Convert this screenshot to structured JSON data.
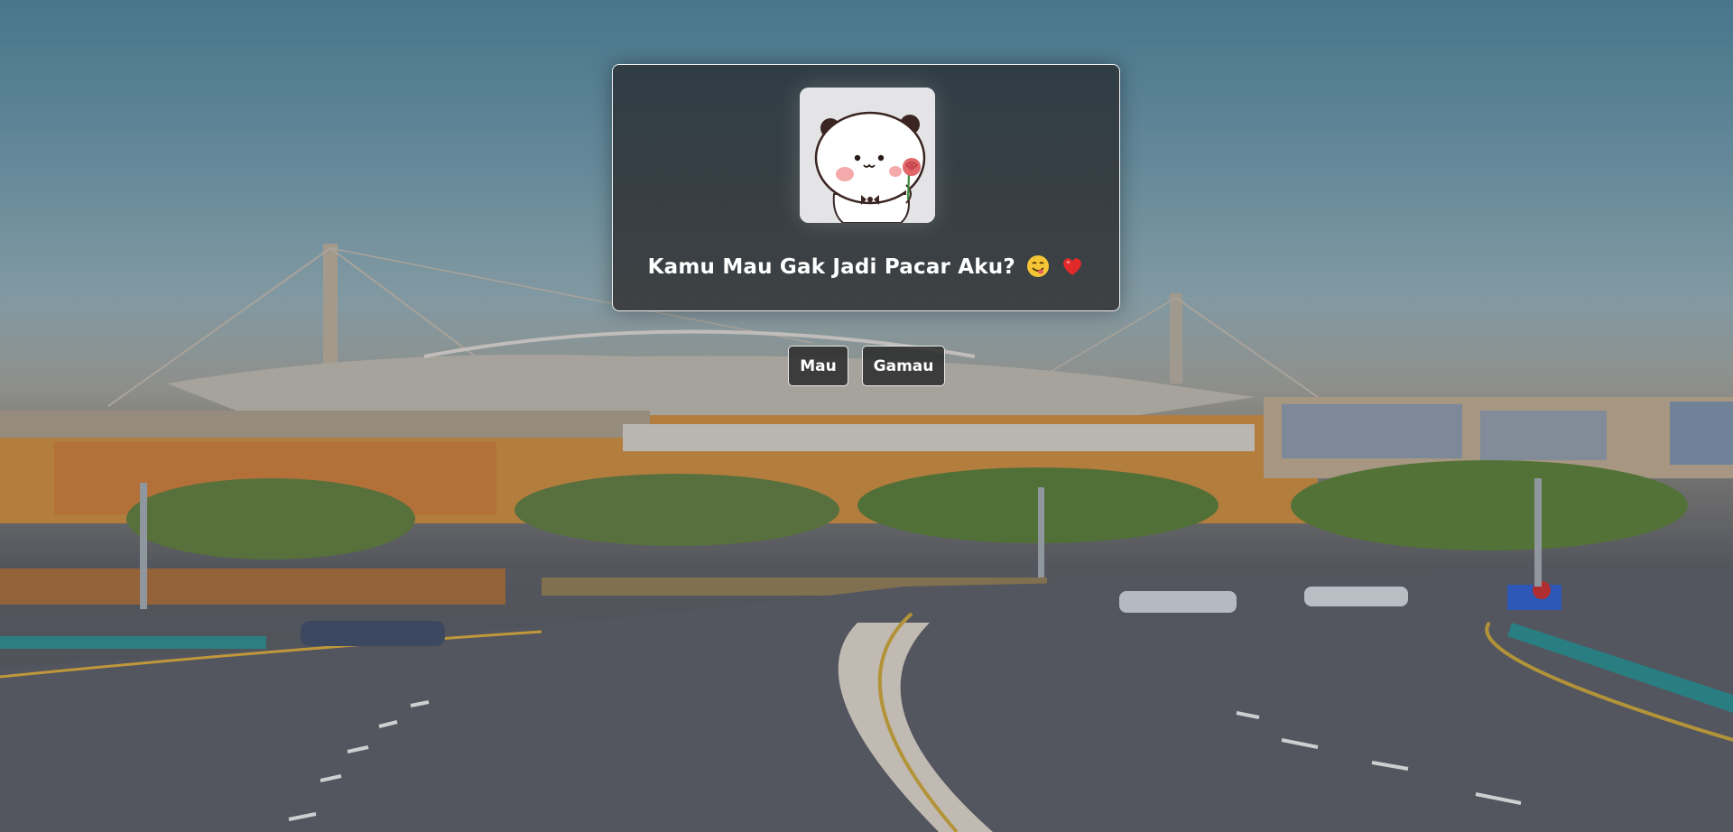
{
  "card": {
    "question": "Kamu Mau Gak Jadi Pacar Aku?",
    "emoji_1_icon": "smiling-tongue-emoji",
    "emoji_2_icon": "red-heart-emoji",
    "sticker_icon": "panda-holding-rose-sticker"
  },
  "actions": {
    "yes_label": "Mau",
    "no_label": "Gamau"
  },
  "colors": {
    "card_background": "#34393e",
    "card_border": "#f2f2f2",
    "button_background": "#2c2e2e",
    "text": "#ffffff"
  }
}
